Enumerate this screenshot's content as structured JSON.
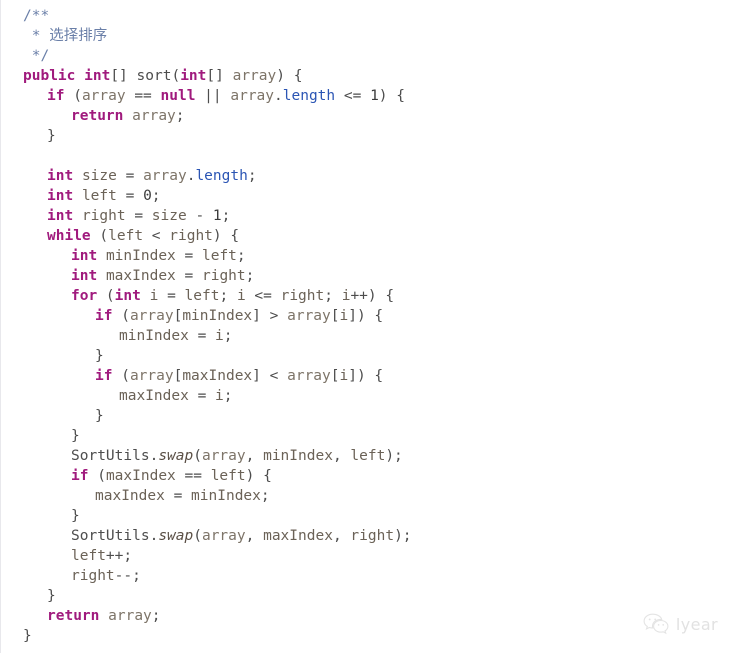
{
  "page": {
    "kind": "code-snippet-image",
    "language": "Java",
    "background_color": "#ffffff"
  },
  "theme": {
    "comment_color": "#6a7fa8",
    "keyword_color": "#a01a7d",
    "field_color": "#2b55b4",
    "identifier_color": "#7d7468",
    "default_text_color": "#4d4d4d",
    "static_method_color": "#5a4f45",
    "watermark_color": "#e2e2e2"
  },
  "code": {
    "title_comment": "选择排序",
    "lines": [
      {
        "indent": 0,
        "tokens": [
          {
            "t": "/**",
            "c": "cmt"
          }
        ]
      },
      {
        "indent": 0,
        "tokens": [
          {
            "t": " * ",
            "c": "cmt"
          },
          {
            "t": "选择排序",
            "c": "cmt-cn"
          }
        ]
      },
      {
        "indent": 0,
        "tokens": [
          {
            "t": " */",
            "c": "cmt"
          }
        ]
      },
      {
        "indent": 0,
        "tokens": [
          {
            "t": "public",
            "c": "kw"
          },
          {
            "t": " ",
            "c": "op"
          },
          {
            "t": "int",
            "c": "kw"
          },
          {
            "t": "[] ",
            "c": "br"
          },
          {
            "t": "sort",
            "c": "fn"
          },
          {
            "t": "(",
            "c": "pn"
          },
          {
            "t": "int",
            "c": "kw"
          },
          {
            "t": "[] ",
            "c": "br"
          },
          {
            "t": "array",
            "c": "id"
          },
          {
            "t": ") {",
            "c": "pn"
          }
        ]
      },
      {
        "indent": 1,
        "tokens": [
          {
            "t": "if",
            "c": "kw"
          },
          {
            "t": " (",
            "c": "pn"
          },
          {
            "t": "array",
            "c": "id"
          },
          {
            "t": " == ",
            "c": "op"
          },
          {
            "t": "null",
            "c": "kw"
          },
          {
            "t": " || ",
            "c": "op"
          },
          {
            "t": "array",
            "c": "id"
          },
          {
            "t": ".",
            "c": "op"
          },
          {
            "t": "length",
            "c": "fld"
          },
          {
            "t": " <= ",
            "c": "op"
          },
          {
            "t": "1",
            "c": "num"
          },
          {
            "t": ") {",
            "c": "pn"
          }
        ]
      },
      {
        "indent": 2,
        "tokens": [
          {
            "t": "return",
            "c": "kw"
          },
          {
            "t": " ",
            "c": "op"
          },
          {
            "t": "array",
            "c": "id"
          },
          {
            "t": ";",
            "c": "op"
          }
        ]
      },
      {
        "indent": 1,
        "tokens": [
          {
            "t": "}",
            "c": "br"
          }
        ]
      },
      {
        "indent": 0,
        "tokens": [
          {
            "t": "",
            "c": "op"
          }
        ]
      },
      {
        "indent": 1,
        "tokens": [
          {
            "t": "int",
            "c": "kw"
          },
          {
            "t": " ",
            "c": "op"
          },
          {
            "t": "size",
            "c": "var"
          },
          {
            "t": " = ",
            "c": "op"
          },
          {
            "t": "array",
            "c": "id"
          },
          {
            "t": ".",
            "c": "op"
          },
          {
            "t": "length",
            "c": "fld"
          },
          {
            "t": ";",
            "c": "op"
          }
        ]
      },
      {
        "indent": 1,
        "tokens": [
          {
            "t": "int",
            "c": "kw"
          },
          {
            "t": " ",
            "c": "op"
          },
          {
            "t": "left",
            "c": "var"
          },
          {
            "t": " = ",
            "c": "op"
          },
          {
            "t": "0",
            "c": "num"
          },
          {
            "t": ";",
            "c": "op"
          }
        ]
      },
      {
        "indent": 1,
        "tokens": [
          {
            "t": "int",
            "c": "kw"
          },
          {
            "t": " ",
            "c": "op"
          },
          {
            "t": "right",
            "c": "var"
          },
          {
            "t": " = ",
            "c": "op"
          },
          {
            "t": "size",
            "c": "var"
          },
          {
            "t": " - ",
            "c": "op"
          },
          {
            "t": "1",
            "c": "num"
          },
          {
            "t": ";",
            "c": "op"
          }
        ]
      },
      {
        "indent": 1,
        "tokens": [
          {
            "t": "while",
            "c": "kw"
          },
          {
            "t": " (",
            "c": "pn"
          },
          {
            "t": "left",
            "c": "var"
          },
          {
            "t": " < ",
            "c": "op"
          },
          {
            "t": "right",
            "c": "var"
          },
          {
            "t": ") {",
            "c": "pn"
          }
        ]
      },
      {
        "indent": 2,
        "tokens": [
          {
            "t": "int",
            "c": "kw"
          },
          {
            "t": " ",
            "c": "op"
          },
          {
            "t": "minIndex",
            "c": "var"
          },
          {
            "t": " = ",
            "c": "op"
          },
          {
            "t": "left",
            "c": "var"
          },
          {
            "t": ";",
            "c": "op"
          }
        ]
      },
      {
        "indent": 2,
        "tokens": [
          {
            "t": "int",
            "c": "kw"
          },
          {
            "t": " ",
            "c": "op"
          },
          {
            "t": "maxIndex",
            "c": "var"
          },
          {
            "t": " = ",
            "c": "op"
          },
          {
            "t": "right",
            "c": "var"
          },
          {
            "t": ";",
            "c": "op"
          }
        ]
      },
      {
        "indent": 2,
        "tokens": [
          {
            "t": "for",
            "c": "kw"
          },
          {
            "t": " (",
            "c": "pn"
          },
          {
            "t": "int",
            "c": "kw"
          },
          {
            "t": " ",
            "c": "op"
          },
          {
            "t": "i",
            "c": "var"
          },
          {
            "t": " = ",
            "c": "op"
          },
          {
            "t": "left",
            "c": "var"
          },
          {
            "t": "; ",
            "c": "op"
          },
          {
            "t": "i",
            "c": "var"
          },
          {
            "t": " <= ",
            "c": "op"
          },
          {
            "t": "right",
            "c": "var"
          },
          {
            "t": "; ",
            "c": "op"
          },
          {
            "t": "i",
            "c": "var"
          },
          {
            "t": "++) {",
            "c": "pn"
          }
        ]
      },
      {
        "indent": 3,
        "tokens": [
          {
            "t": "if",
            "c": "kw"
          },
          {
            "t": " (",
            "c": "pn"
          },
          {
            "t": "array",
            "c": "id"
          },
          {
            "t": "[",
            "c": "br"
          },
          {
            "t": "minIndex",
            "c": "var"
          },
          {
            "t": "]",
            "c": "br"
          },
          {
            "t": " > ",
            "c": "op"
          },
          {
            "t": "array",
            "c": "id"
          },
          {
            "t": "[",
            "c": "br"
          },
          {
            "t": "i",
            "c": "var"
          },
          {
            "t": "]) {",
            "c": "pn"
          }
        ]
      },
      {
        "indent": 4,
        "tokens": [
          {
            "t": "minIndex",
            "c": "var"
          },
          {
            "t": " = ",
            "c": "op"
          },
          {
            "t": "i",
            "c": "var"
          },
          {
            "t": ";",
            "c": "op"
          }
        ]
      },
      {
        "indent": 3,
        "tokens": [
          {
            "t": "}",
            "c": "br"
          }
        ]
      },
      {
        "indent": 3,
        "tokens": [
          {
            "t": "if",
            "c": "kw"
          },
          {
            "t": " (",
            "c": "pn"
          },
          {
            "t": "array",
            "c": "id"
          },
          {
            "t": "[",
            "c": "br"
          },
          {
            "t": "maxIndex",
            "c": "var"
          },
          {
            "t": "]",
            "c": "br"
          },
          {
            "t": " < ",
            "c": "op"
          },
          {
            "t": "array",
            "c": "id"
          },
          {
            "t": "[",
            "c": "br"
          },
          {
            "t": "i",
            "c": "var"
          },
          {
            "t": "]) {",
            "c": "pn"
          }
        ]
      },
      {
        "indent": 4,
        "tokens": [
          {
            "t": "maxIndex",
            "c": "var"
          },
          {
            "t": " = ",
            "c": "op"
          },
          {
            "t": "i",
            "c": "var"
          },
          {
            "t": ";",
            "c": "op"
          }
        ]
      },
      {
        "indent": 3,
        "tokens": [
          {
            "t": "}",
            "c": "br"
          }
        ]
      },
      {
        "indent": 2,
        "tokens": [
          {
            "t": "}",
            "c": "br"
          }
        ]
      },
      {
        "indent": 2,
        "tokens": [
          {
            "t": "SortUtils",
            "c": "cls"
          },
          {
            "t": ".",
            "c": "op"
          },
          {
            "t": "swap",
            "c": "mth"
          },
          {
            "t": "(",
            "c": "pn"
          },
          {
            "t": "array",
            "c": "id"
          },
          {
            "t": ", ",
            "c": "op"
          },
          {
            "t": "minIndex",
            "c": "var"
          },
          {
            "t": ", ",
            "c": "op"
          },
          {
            "t": "left",
            "c": "var"
          },
          {
            "t": ");",
            "c": "pn"
          }
        ]
      },
      {
        "indent": 2,
        "tokens": [
          {
            "t": "if",
            "c": "kw"
          },
          {
            "t": " (",
            "c": "pn"
          },
          {
            "t": "maxIndex",
            "c": "var"
          },
          {
            "t": " == ",
            "c": "op"
          },
          {
            "t": "left",
            "c": "var"
          },
          {
            "t": ") {",
            "c": "pn"
          }
        ]
      },
      {
        "indent": 3,
        "tokens": [
          {
            "t": "maxIndex",
            "c": "var"
          },
          {
            "t": " = ",
            "c": "op"
          },
          {
            "t": "minIndex",
            "c": "var"
          },
          {
            "t": ";",
            "c": "op"
          }
        ]
      },
      {
        "indent": 2,
        "tokens": [
          {
            "t": "}",
            "c": "br"
          }
        ]
      },
      {
        "indent": 2,
        "tokens": [
          {
            "t": "SortUtils",
            "c": "cls"
          },
          {
            "t": ".",
            "c": "op"
          },
          {
            "t": "swap",
            "c": "mth"
          },
          {
            "t": "(",
            "c": "pn"
          },
          {
            "t": "array",
            "c": "id"
          },
          {
            "t": ", ",
            "c": "op"
          },
          {
            "t": "maxIndex",
            "c": "var"
          },
          {
            "t": ", ",
            "c": "op"
          },
          {
            "t": "right",
            "c": "var"
          },
          {
            "t": ");",
            "c": "pn"
          }
        ]
      },
      {
        "indent": 2,
        "tokens": [
          {
            "t": "left",
            "c": "var"
          },
          {
            "t": "++;",
            "c": "op"
          }
        ]
      },
      {
        "indent": 2,
        "tokens": [
          {
            "t": "right",
            "c": "var"
          },
          {
            "t": "--;",
            "c": "op"
          }
        ]
      },
      {
        "indent": 1,
        "tokens": [
          {
            "t": "}",
            "c": "br"
          }
        ]
      },
      {
        "indent": 1,
        "tokens": [
          {
            "t": "return",
            "c": "kw"
          },
          {
            "t": " ",
            "c": "op"
          },
          {
            "t": "array",
            "c": "id"
          },
          {
            "t": ";",
            "c": "op"
          }
        ]
      },
      {
        "indent": 0,
        "tokens": [
          {
            "t": "}",
            "c": "br"
          }
        ]
      }
    ]
  },
  "watermark": {
    "icon": "wechat-icon",
    "text": "lyear"
  }
}
